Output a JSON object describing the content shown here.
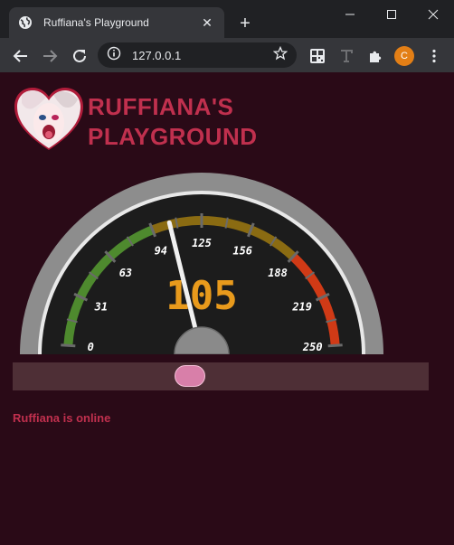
{
  "browser": {
    "tab_title": "Ruffiana's Playground",
    "url": "127.0.0.1",
    "profile_initial": "C"
  },
  "page": {
    "title_line1": "RUFFIANA'S",
    "title_line2": "PLAYGROUND",
    "status_text": "Ruffiana is online"
  },
  "gauge": {
    "min": 0,
    "max": 250,
    "value": 105,
    "value_text": "105",
    "tick_labels": [
      "0",
      "31",
      "63",
      "94",
      "125",
      "156",
      "188",
      "219",
      "250"
    ],
    "bands": [
      {
        "from": 0,
        "to": 94,
        "color": "#4e8a2e"
      },
      {
        "from": 94,
        "to": 188,
        "color": "#8a6b12"
      },
      {
        "from": 188,
        "to": 250,
        "color": "#d03a16"
      }
    ],
    "value_color": "#e89a1c"
  },
  "slider": {
    "level": 0.42
  }
}
